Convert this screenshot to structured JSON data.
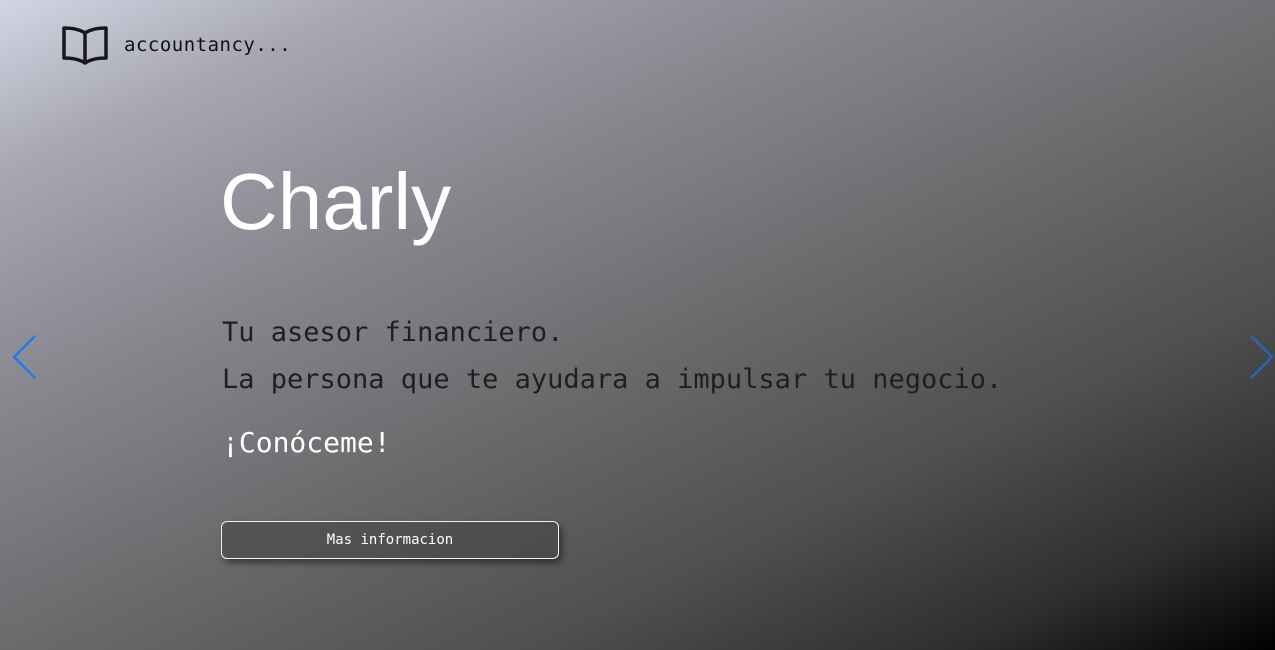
{
  "brand": {
    "logo_icon": "open-book-icon",
    "name": "accountancy..."
  },
  "hero": {
    "title": "Charly",
    "tagline_line1": "Tu asesor financiero.",
    "tagline_line2": "La persona que te ayudara a impulsar tu negocio.",
    "cta_text": "¡Conóceme!",
    "button_label": "Mas informacion"
  },
  "carousel": {
    "prev_icon": "chevron-left-icon",
    "next_icon": "chevron-right-icon",
    "left_arrow_color": "#1e7bf0",
    "right_arrow_color": "#2a66b8"
  },
  "colors": {
    "title": "#ffffff",
    "tagline": "#1f1f22",
    "brand_text": "#111111"
  }
}
